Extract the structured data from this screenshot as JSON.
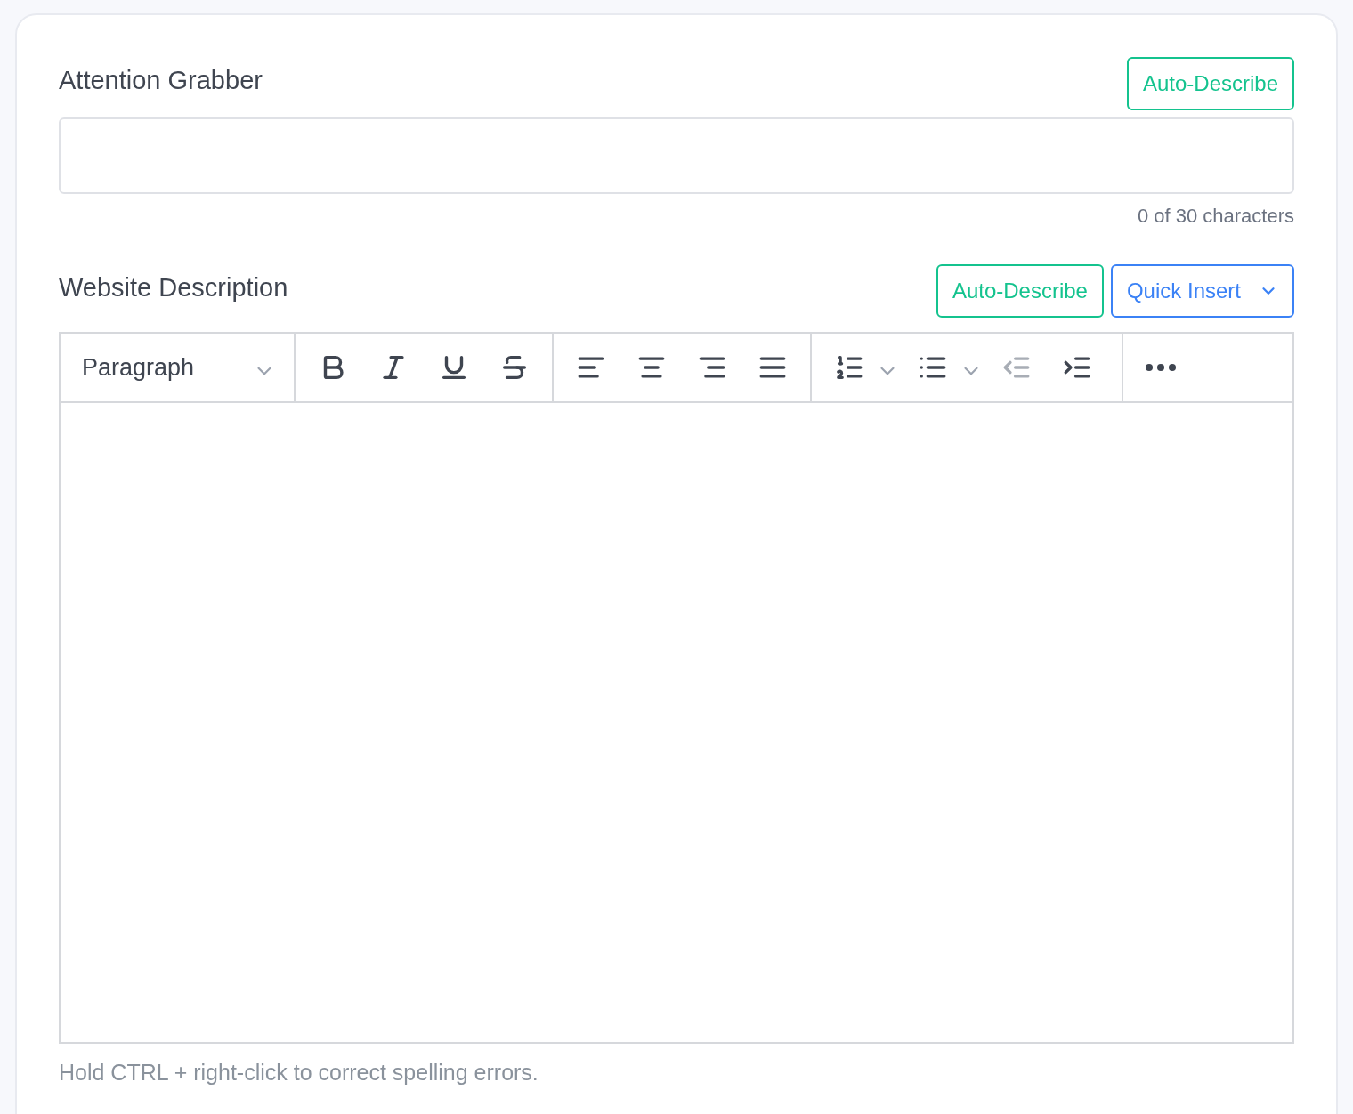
{
  "attention_grabber": {
    "label": "Attention Grabber",
    "buttons": [
      {
        "label": "Auto-Describe",
        "kind": "auto"
      }
    ],
    "counter": "0 of 30 characters"
  },
  "website_description": {
    "label": "Website Description",
    "buttons": [
      {
        "label": "Auto-Describe",
        "kind": "auto"
      },
      {
        "label": "Quick Insert",
        "kind": "menu"
      }
    ],
    "block_format": "Paragraph",
    "toolbar_groups": [
      [
        {
          "kind": "bold",
          "disabled": false
        },
        {
          "kind": "italic",
          "disabled": false
        },
        {
          "kind": "underline",
          "disabled": false
        },
        {
          "kind": "strikethrough",
          "disabled": false
        }
      ],
      [
        {
          "kind": "align-left",
          "disabled": false
        },
        {
          "kind": "align-center",
          "disabled": false
        },
        {
          "kind": "align-right",
          "disabled": false
        },
        {
          "kind": "justify",
          "disabled": false
        }
      ],
      [
        {
          "kind": "numbered-list",
          "disabled": false,
          "dropdown": true
        },
        {
          "kind": "bulleted-list",
          "disabled": false,
          "dropdown": true
        },
        {
          "kind": "outdent",
          "disabled": true
        },
        {
          "kind": "indent",
          "disabled": false
        }
      ],
      [
        {
          "kind": "more",
          "disabled": false
        }
      ]
    ],
    "hint": "Hold CTRL + right-click to correct spelling errors."
  }
}
